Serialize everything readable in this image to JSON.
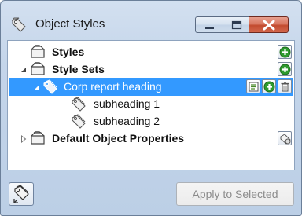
{
  "window": {
    "title": "Object Styles",
    "controls": [
      "minimize",
      "maximize",
      "close"
    ]
  },
  "tree": {
    "items": [
      {
        "label": "Styles",
        "bold": true,
        "icon": "styles-folder-icon",
        "action": "add-icon"
      },
      {
        "label": "Style Sets",
        "bold": true,
        "expanded": true,
        "icon": "style-sets-folder-icon",
        "action": "add-icon"
      },
      {
        "label": "Corp report heading",
        "bold": false,
        "selected": true,
        "expanded": true,
        "icon": "style-set-icon",
        "actions": [
          "edit-icon",
          "add-icon",
          "delete-icon"
        ]
      },
      {
        "label": "subheading 1",
        "bold": false,
        "icon": "style-icon"
      },
      {
        "label": "subheading 2",
        "bold": false,
        "icon": "style-icon"
      },
      {
        "label": "Default Object Properties",
        "bold": true,
        "expanded": false,
        "icon": "default-properties-icon",
        "action": "properties-icon"
      }
    ]
  },
  "footer": {
    "grip": "...",
    "apply_label": "Apply to Selected",
    "apply_enabled": false,
    "left_button_icon": "new-style-from-selection-icon"
  },
  "colors": {
    "selection": "#3399ff",
    "add_green": "#2e9a2e",
    "close_red": "#c24b2f"
  }
}
